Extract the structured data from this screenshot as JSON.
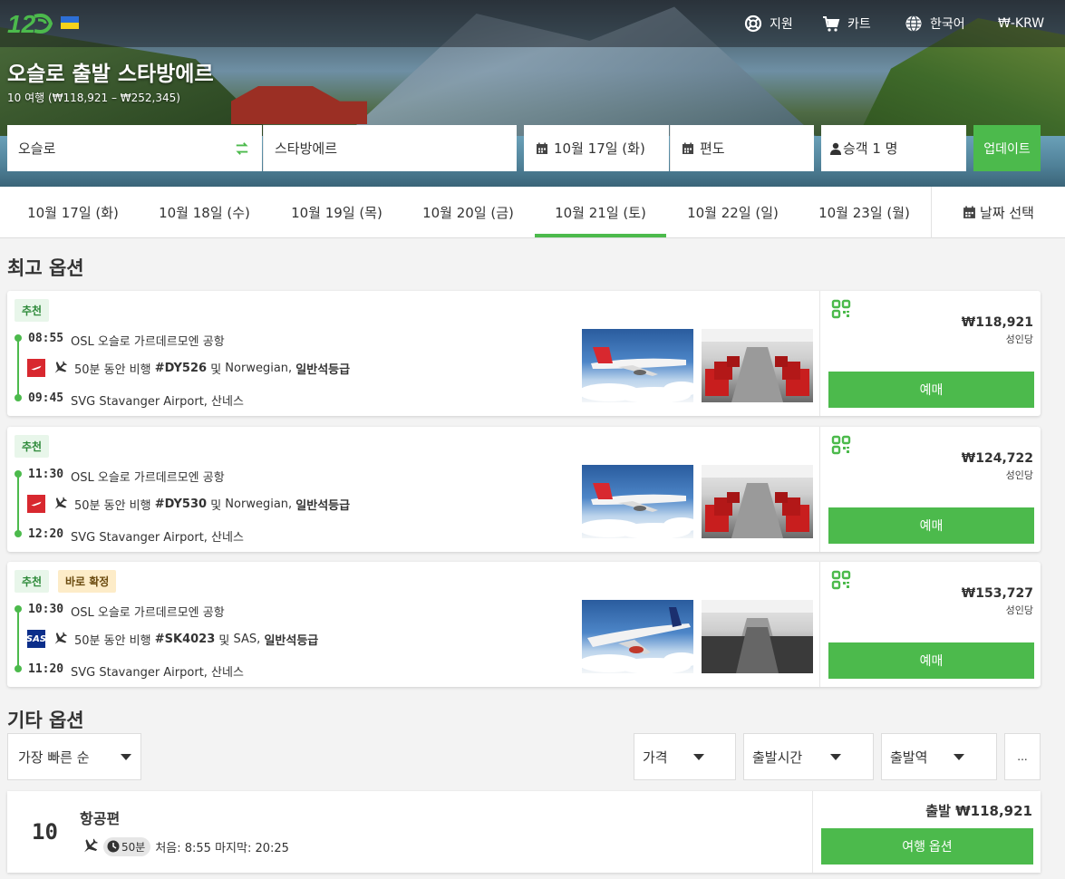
{
  "header": {
    "logo_text": "12GO",
    "nav": {
      "support": "지원",
      "cart": "카트",
      "language": "한국어",
      "currency": "₩-KRW"
    },
    "title": "오슬로 출발 스타방에르",
    "subtitle": "10 여행 (₩118,921 – ₩252,345)"
  },
  "search": {
    "from": "오슬로",
    "to": "스타방에르",
    "depart_date": "10월 17일 (화)",
    "return": "편도",
    "passengers": "승객 1 명",
    "update_label": "업데이트"
  },
  "date_tabs": [
    {
      "label": "10월 17일 (화)"
    },
    {
      "label": "10월 18일 (수)"
    },
    {
      "label": "10월 19일 (목)"
    },
    {
      "label": "10월 20일 (금)"
    },
    {
      "label": "10월 21일 (토)",
      "active": true
    },
    {
      "label": "10월 22일 (일)"
    },
    {
      "label": "10월 23일 (월)"
    }
  ],
  "date_pick_label": "날짜 선택",
  "best_title": "최고 옵션",
  "other_title": "기타 옵션",
  "offers": [
    {
      "badges": [
        "추천"
      ],
      "dep_time": "08:55",
      "dep_place": "OSL 오슬로 가르데르모엔 공항",
      "duration": "50분 동안 비행",
      "flight_no": "#DY526",
      "and": "및",
      "carrier": "Norwegian,",
      "class": "일반석등급",
      "arr_time": "09:45",
      "arr_place": "SVG Stavanger Airport, 산네스",
      "airline": "norwegian",
      "price": "₩118,921",
      "per": "성인당",
      "buy": "예매"
    },
    {
      "badges": [
        "추천"
      ],
      "dep_time": "11:30",
      "dep_place": "OSL 오슬로 가르데르모엔 공항",
      "duration": "50분 동안 비행",
      "flight_no": "#DY530",
      "and": "및",
      "carrier": "Norwegian,",
      "class": "일반석등급",
      "arr_time": "12:20",
      "arr_place": "SVG Stavanger Airport, 산네스",
      "airline": "norwegian",
      "price": "₩124,722",
      "per": "성인당",
      "buy": "예매"
    },
    {
      "badges": [
        "추천",
        "바로 확정"
      ],
      "dep_time": "10:30",
      "dep_place": "OSL 오슬로 가르데르모엔 공항",
      "duration": "50분 동안 비행",
      "flight_no": "#SK4023",
      "and": "및",
      "carrier": "SAS,",
      "class": "일반석등급",
      "arr_time": "11:20",
      "arr_place": "SVG Stavanger Airport, 산네스",
      "airline": "sas",
      "price": "₩153,727",
      "per": "성인당",
      "buy": "예매"
    }
  ],
  "sas_logo_text": "SAS",
  "filters": {
    "sort": "가장 빠른 순",
    "price": "가격",
    "depart_time": "출발시간",
    "station": "출발역",
    "more": "..."
  },
  "group": {
    "count": "10",
    "title": "항공편",
    "duration": "50분",
    "first_last": "처음: 8:55 마지막: 20:25",
    "price": "출발 ₩118,921",
    "button": "여행 옵션"
  },
  "colors": {
    "accent": "#4cba4c",
    "norwegian_red": "#d8282f",
    "sas_blue": "#0b2e8a"
  }
}
